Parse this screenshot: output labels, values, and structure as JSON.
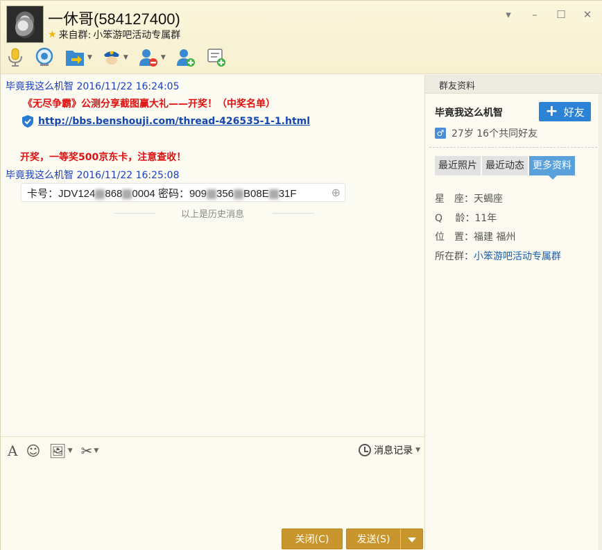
{
  "header": {
    "title": "一休哥(584127400)",
    "from_label": "来自群:",
    "group_name": "小笨游吧活动专属群"
  },
  "toolbar": {
    "items": [
      "microphone-icon",
      "webcam-icon",
      "file-transfer-icon",
      "police-icon",
      "remove-user-icon",
      "add-user-icon",
      "message-add-icon"
    ]
  },
  "chat": {
    "messages": [
      {
        "sender": "毕竟我这么机智",
        "time": "2016/11/22 16:24:05"
      },
      {
        "sender": "毕竟我这么机智",
        "time": "2016/11/22 16:25:08"
      }
    ],
    "announce_title": "《无尽争霸》公测分享截图赢大礼——开奖！（中奖名单）",
    "link": "http://bbs.benshouji.com/thread-426535-1-1.html",
    "prize_line": "开奖，一等奖500京东卡，注意查收！",
    "card_text_a": "卡号：JDV124",
    "card_text_b": "868",
    "card_text_c": "0004 密码：909",
    "card_text_d": "356",
    "card_text_e": "B08E",
    "card_text_f": "31F",
    "history_label": "以上是历史消息"
  },
  "input_toolbar": {
    "history_button": "消息记录"
  },
  "buttons": {
    "close": "关闭(C)",
    "send": "发送(S)"
  },
  "right_panel": {
    "header": "群友资料",
    "name": "毕竟我这么机智",
    "add_friend": "好友",
    "stats": "27岁 16个共同好友",
    "tabs": [
      "最近照片",
      "最近动态",
      "更多资料"
    ],
    "active_tab": "更多资料",
    "info": {
      "constellation_label": "星　座：",
      "constellation": "天蝎座",
      "qage_label": "Q　 龄：",
      "qage": "11年",
      "location_label": "位　置：",
      "location": "福建 福州",
      "group_label": "所在群：",
      "group": "小笨游吧活动专属群"
    }
  },
  "colors": {
    "accent": "#2c83d5",
    "button": "#c8962c",
    "sender": "#1a3fc6",
    "highlight": "#e01010"
  }
}
